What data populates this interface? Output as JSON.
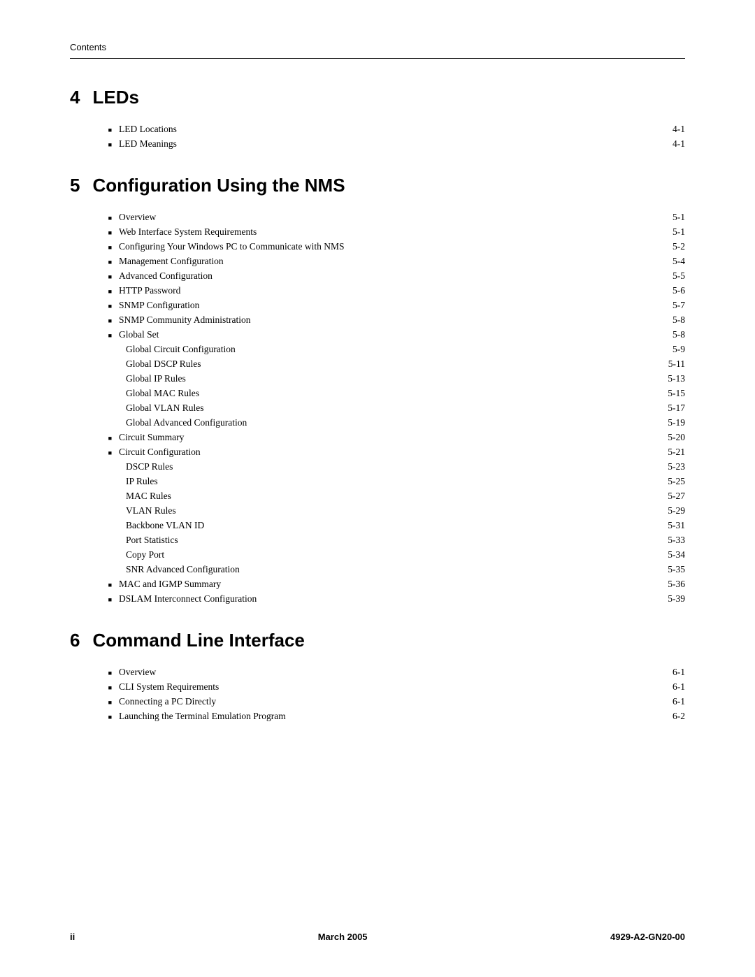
{
  "header": {
    "label": "Contents"
  },
  "chapters": [
    {
      "id": "ch4",
      "number": "4",
      "title": "LEDs",
      "items": [
        {
          "type": "bullet",
          "label": "LED Locations",
          "page": "4-1",
          "dots": true
        },
        {
          "type": "bullet",
          "label": "LED Meanings",
          "page": "4-1",
          "dots": true
        }
      ]
    },
    {
      "id": "ch5",
      "number": "5",
      "title": "Configuration Using the NMS",
      "items": [
        {
          "type": "bullet",
          "label": "Overview",
          "page": "5-1",
          "dots": true
        },
        {
          "type": "bullet",
          "label": "Web Interface System Requirements",
          "page": "5-1",
          "dots": true
        },
        {
          "type": "bullet",
          "label": "Configuring Your Windows PC to Communicate with NMS",
          "page": "5-2",
          "dots": true
        },
        {
          "type": "bullet",
          "label": "Management Configuration",
          "page": "5-4",
          "dots": true
        },
        {
          "type": "bullet",
          "label": "Advanced Configuration",
          "page": "5-5",
          "dots": true
        },
        {
          "type": "bullet",
          "label": "HTTP Password",
          "page": "5-6",
          "dots": true
        },
        {
          "type": "bullet",
          "label": "SNMP Configuration",
          "page": "5-7",
          "dots": true
        },
        {
          "type": "bullet",
          "label": "SNMP Community Administration",
          "page": "5-8",
          "dots": true
        },
        {
          "type": "bullet",
          "label": "Global Set",
          "page": "5-8",
          "dots": true
        },
        {
          "type": "sub",
          "label": "Global Circuit Configuration",
          "page": "5-9",
          "dots": true
        },
        {
          "type": "sub",
          "label": "Global DSCP Rules",
          "page": "5-11",
          "dots": true
        },
        {
          "type": "sub",
          "label": "Global IP Rules",
          "page": "5-13",
          "dots": true
        },
        {
          "type": "sub",
          "label": "Global MAC Rules",
          "page": "5-15",
          "dots": true
        },
        {
          "type": "sub",
          "label": "Global VLAN Rules",
          "page": "5-17",
          "dots": true
        },
        {
          "type": "sub",
          "label": "Global Advanced Configuration",
          "page": "5-19",
          "dots": true
        },
        {
          "type": "bullet",
          "label": "Circuit Summary",
          "page": "5-20",
          "dots": true
        },
        {
          "type": "bullet",
          "label": "Circuit Configuration",
          "page": "5-21",
          "dots": true
        },
        {
          "type": "sub",
          "label": "DSCP Rules",
          "page": "5-23",
          "dots": true
        },
        {
          "type": "sub",
          "label": "IP Rules",
          "page": "5-25",
          "dots": true
        },
        {
          "type": "sub",
          "label": "MAC Rules",
          "page": "5-27",
          "dots": true
        },
        {
          "type": "sub",
          "label": "VLAN Rules",
          "page": "5-29",
          "dots": true
        },
        {
          "type": "sub",
          "label": "Backbone VLAN ID",
          "page": "5-31",
          "dots": true
        },
        {
          "type": "sub",
          "label": "Port Statistics",
          "page": "5-33",
          "dots": true
        },
        {
          "type": "sub",
          "label": "Copy Port",
          "page": "5-34",
          "dots": true
        },
        {
          "type": "sub",
          "label": "SNR Advanced Configuration",
          "page": "5-35",
          "dots": true
        },
        {
          "type": "bullet",
          "label": "MAC and IGMP Summary",
          "page": "5-36",
          "dots": true
        },
        {
          "type": "bullet",
          "label": "DSLAM Interconnect Configuration",
          "page": "5-39",
          "dots": true
        }
      ]
    },
    {
      "id": "ch6",
      "number": "6",
      "title": "Command Line Interface",
      "items": [
        {
          "type": "bullet",
          "label": "Overview",
          "page": "6-1",
          "dots": true
        },
        {
          "type": "bullet",
          "label": "CLI System Requirements",
          "page": "6-1",
          "dots": true
        },
        {
          "type": "bullet",
          "label": "Connecting a PC Directly",
          "page": "6-1",
          "dots": true
        },
        {
          "type": "bullet",
          "label": "Launching the Terminal Emulation Program",
          "page": "6-2",
          "dots": true
        }
      ]
    }
  ],
  "footer": {
    "left": "ii",
    "center": "March 2005",
    "right": "4929-A2-GN20-00"
  }
}
